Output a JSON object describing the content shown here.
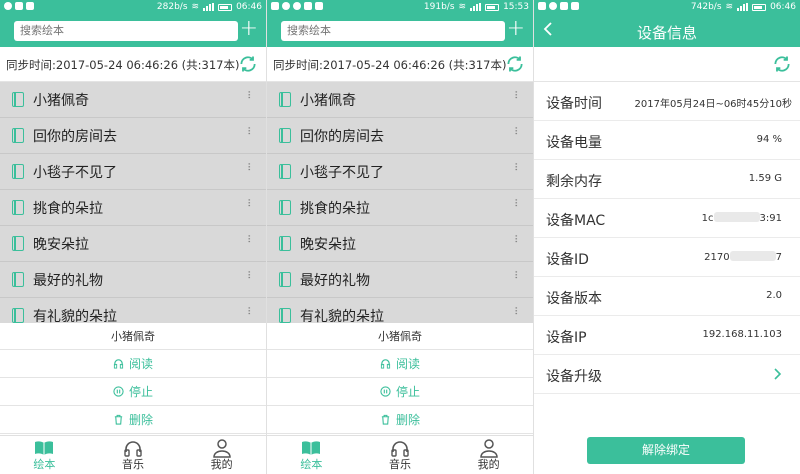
{
  "accent_color": "#3bbf9b",
  "screens": [
    {
      "status": {
        "speed": "282b/s",
        "battery_icon": "battery-icon",
        "time": "06:46"
      },
      "search": {
        "placeholder": "搜索绘本"
      },
      "sync_text": "同步时间:2017-05-24 06:46:26 (共:317本)",
      "books": [
        "小猪佩奇",
        "回你的房间去",
        "小毯子不见了",
        "挑食的朵拉",
        "晚安朵拉",
        "最好的礼物",
        "有礼貌的朵拉"
      ],
      "sheet": {
        "title": "小猪佩奇",
        "read": "阅读",
        "stop": "停止",
        "delete": "删除"
      },
      "tabs": [
        "绘本",
        "音乐",
        "我的"
      ]
    },
    {
      "status": {
        "speed": "191b/s",
        "battery_icon": "battery-icon",
        "time": "15:53"
      },
      "search": {
        "placeholder": "搜索绘本"
      },
      "sync_text": "同步时间:2017-05-24 06:46:26 (共:317本)",
      "books": [
        "小猪佩奇",
        "回你的房间去",
        "小毯子不见了",
        "挑食的朵拉",
        "晚安朵拉",
        "最好的礼物",
        "有礼貌的朵拉"
      ],
      "sheet": {
        "title": "小猪佩奇",
        "read": "阅读",
        "stop": "停止",
        "delete": "删除"
      },
      "tabs": [
        "绘本",
        "音乐",
        "我的"
      ]
    },
    {
      "status": {
        "speed": "742b/s",
        "battery_icon": "battery-icon",
        "time": "06:46"
      },
      "title": "设备信息",
      "rows": [
        {
          "label": "设备时间",
          "value": "2017年05月24日~06时45分10秒"
        },
        {
          "label": "设备电量",
          "value": "94 %"
        },
        {
          "label": "剩余内存",
          "value": "1.59 G"
        },
        {
          "label": "设备MAC",
          "value_prefix": "1c",
          "value_suffix": "3:91"
        },
        {
          "label": "设备ID",
          "value_prefix": "2170",
          "value_suffix": "7"
        },
        {
          "label": "设备版本",
          "value": "2.0"
        },
        {
          "label": "设备IP",
          "value": "192.168.11.103"
        },
        {
          "label": "设备升级",
          "value": ""
        }
      ],
      "unbind": "解除绑定"
    }
  ]
}
